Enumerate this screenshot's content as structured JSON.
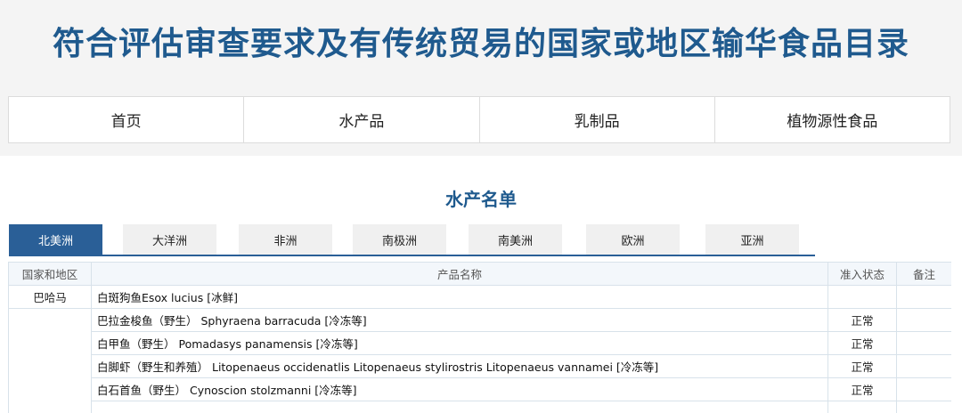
{
  "site": {
    "title": "符合评估审查要求及有传统贸易的国家或地区输华食品目录"
  },
  "nav": {
    "items": [
      {
        "label": "首页"
      },
      {
        "label": "水产品"
      },
      {
        "label": "乳制品"
      },
      {
        "label": "植物源性食品"
      }
    ]
  },
  "section": {
    "title": "水产名单"
  },
  "tabs": {
    "active": "北美洲",
    "items": [
      {
        "label": "北美洲"
      },
      {
        "label": "大洋洲"
      },
      {
        "label": "非洲"
      },
      {
        "label": "南极洲"
      },
      {
        "label": "南美洲"
      },
      {
        "label": "欧洲"
      },
      {
        "label": "亚洲"
      }
    ]
  },
  "table": {
    "headers": {
      "country": "国家和地区",
      "product": "产品名称",
      "status": "准入状态",
      "remark": "备注"
    },
    "rows": [
      {
        "country": "巴哈马",
        "product": "白斑狗鱼Esox lucius [冰鲜]",
        "status": "",
        "remark": ""
      },
      {
        "country": "",
        "product": "巴拉金梭鱼（野生） Sphyraena barracuda [冷冻等]",
        "status": "正常",
        "remark": ""
      },
      {
        "country": "",
        "product": "白甲鱼（野生） Pomadasys panamensis [冷冻等]",
        "status": "正常",
        "remark": ""
      },
      {
        "country": "",
        "product": "白脚虾（野生和养殖） Litopenaeus occidenatlis Litopenaeus stylirostris Litopenaeus vannamei [冷冻等]",
        "status": "正常",
        "remark": ""
      },
      {
        "country": "",
        "product": "白石首鱼（野生） Cynoscion stolzmanni [冷冻等]",
        "status": "正常",
        "remark": ""
      }
    ]
  },
  "colors": {
    "brand": "#1f5a8e",
    "tab_active": "#2a5f97"
  }
}
